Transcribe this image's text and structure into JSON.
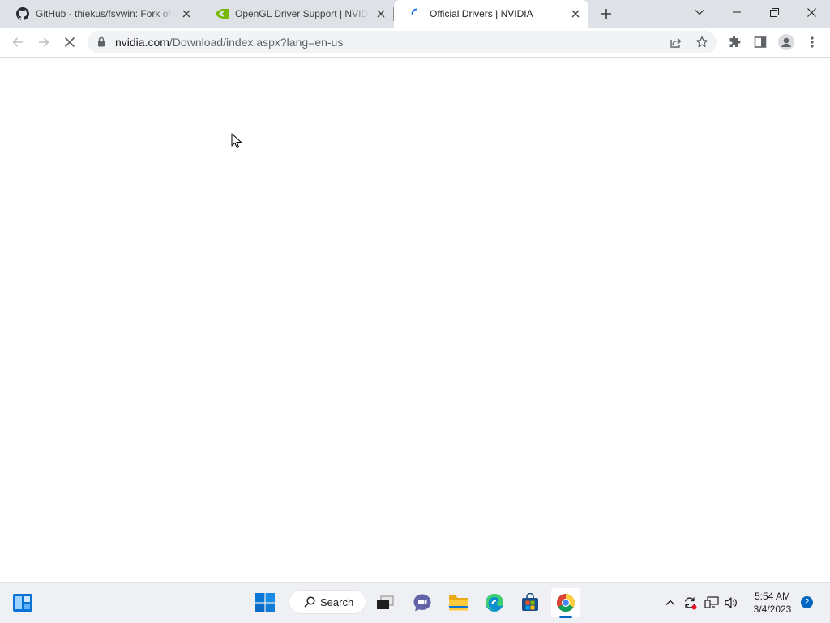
{
  "browser": {
    "tabs": [
      {
        "title": "GitHub - thiekus/fsvwin: Fork of fsvwin",
        "icon": "github-icon",
        "active": false
      },
      {
        "title": "OpenGL Driver Support | NVIDIA",
        "icon": "nvidia-icon",
        "active": false
      },
      {
        "title": "Official Drivers | NVIDIA",
        "icon": "loading-spinner-icon",
        "active": true
      }
    ],
    "address_bar": {
      "host": "nvidia.com",
      "path": "/Download/index.aspx?lang=en-us"
    }
  },
  "taskbar": {
    "search_label": "Search",
    "clock": {
      "time": "5:54 AM",
      "date": "3/4/2023"
    },
    "notification_count": "2"
  },
  "colors": {
    "accent": "#0067c0",
    "nvidia_green": "#76b900",
    "tabstrip": "#dee1e6"
  }
}
